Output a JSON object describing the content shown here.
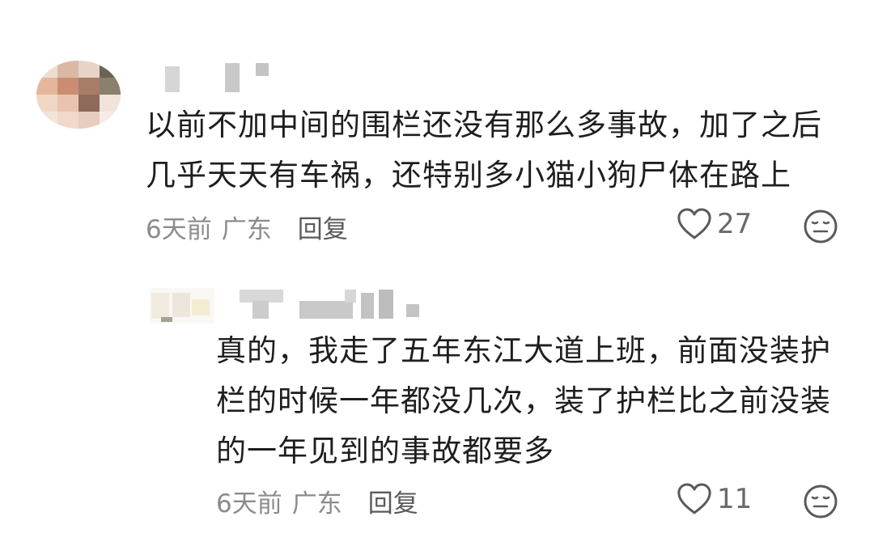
{
  "comments": [
    {
      "text_line1": "以前不加中间的围栏还没有那么多事故，加了之后",
      "text_line2": "几乎天天有车祸，还特别多小猫小狗尸体在路上",
      "time": "6天前",
      "region": "广东",
      "reply_label": "回复",
      "likes": "27",
      "like_icon": "heart-outline-icon",
      "emoji_icon": "neutral-face-icon"
    }
  ],
  "replies": [
    {
      "text_line1": "真的，我走了五年东江大道上班，前面没装护",
      "text_line2": "栏的时候一年都没几次，装了护栏比之前没装",
      "text_line3": "的一年见到的事故都要多",
      "time": "6天前",
      "region": "广东",
      "reply_label": "回复",
      "likes": "11",
      "like_icon": "heart-outline-icon",
      "emoji_icon": "neutral-face-icon"
    }
  ],
  "colors": {
    "text": "#1e1e1e",
    "meta": "#8c8c8c",
    "icon": "#5a5a5a"
  }
}
